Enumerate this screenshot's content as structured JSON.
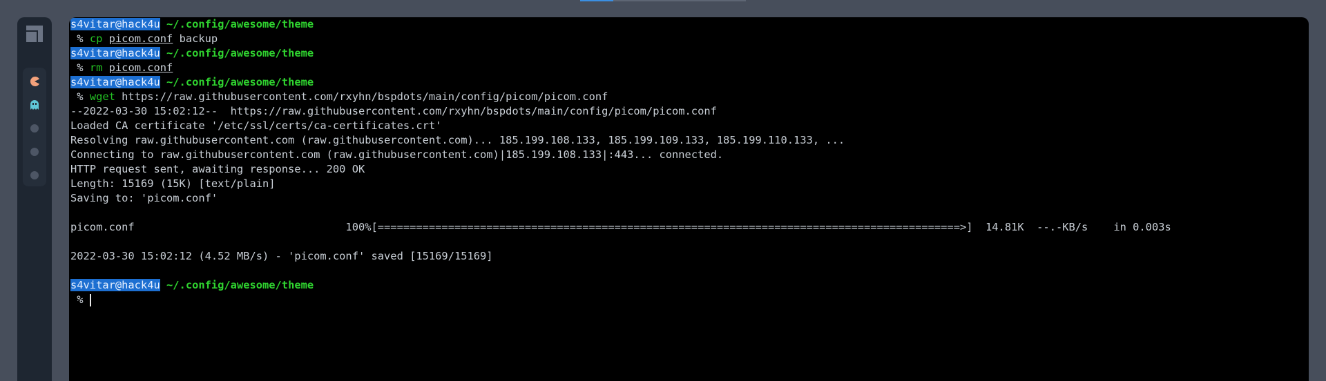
{
  "prompt": {
    "user": "s4vitar@hack4u",
    "path": "~/.config/awesome/theme",
    "symbol": " % "
  },
  "commands": [
    {
      "cmd": "cp",
      "arg1": "picom.conf",
      "arg2": " backup"
    },
    {
      "cmd": "rm",
      "arg1": "picom.conf"
    },
    {
      "cmd": "wget",
      "arg1": " https://raw.githubusercontent.com/rxyhn/bspdots/main/config/picom/picom.conf"
    }
  ],
  "output": {
    "timestamp_line": "--2022-03-30 15:02:12--  https://raw.githubusercontent.com/rxyhn/bspdots/main/config/picom/picom.conf",
    "ca_line": "Loaded CA certificate '/etc/ssl/certs/ca-certificates.crt'",
    "resolving_line": "Resolving raw.githubusercontent.com (raw.githubusercontent.com)... 185.199.108.133, 185.199.109.133, 185.199.110.133, ...",
    "connecting_pre": "Connecting to raw.githubusercontent.com (raw.githubusercontent.com)|",
    "connecting_ip": "185.199.108.133",
    "connecting_post": "|:443... connected.",
    "http_line": "HTTP request sent, awaiting response... 200 OK",
    "length_line": "Length: 15169 (15K) [text/plain]",
    "saving_line": "Saving to: 'picom.conf'",
    "progress_line": "picom.conf                                 100%[===========================================================================================>]  14.81K  --.-KB/s    in 0.003s",
    "saved_line": "2022-03-30 15:02:12 (4.52 MB/s) - 'picom.conf' saved [15169/15169]"
  },
  "icons": {
    "logo": "awesome-logo-icon",
    "ws1": "pacman-icon",
    "ws2": "ghost-icon"
  },
  "colors": {
    "user_bg": "#1d6fd1",
    "path": "#2fd32f",
    "command": "#24c224",
    "pacman": "#f4a27b",
    "ghost": "#5fc7d8"
  }
}
